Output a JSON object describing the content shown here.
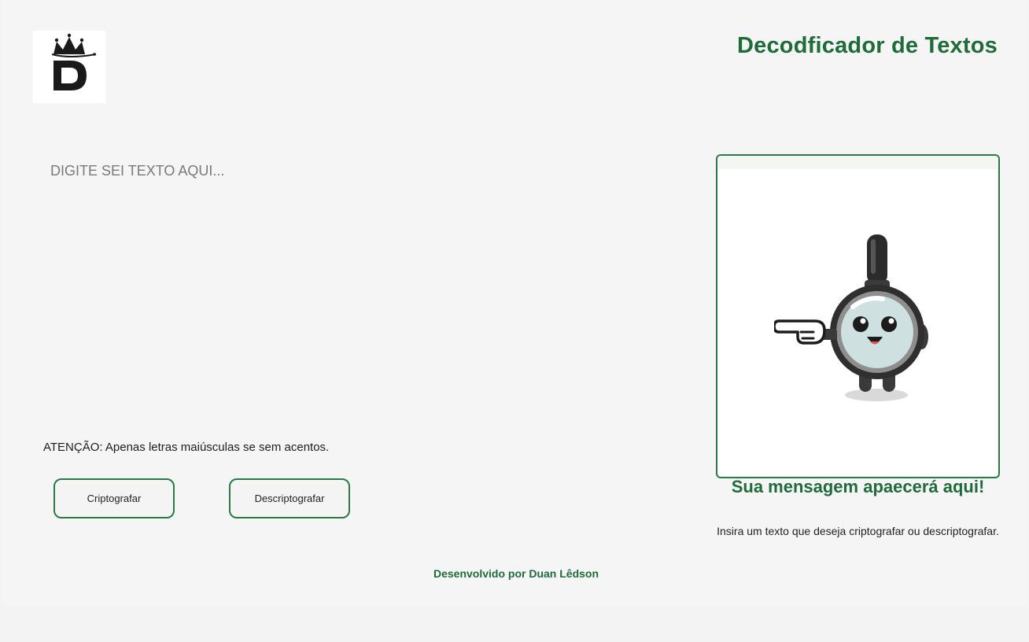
{
  "header": {
    "logo_icon": "crowned-letter-d-logo",
    "title": "Decodficador de Textos"
  },
  "input": {
    "placeholder": "DIGITE SEI TEXTO AQUI...",
    "value": ""
  },
  "warning_text": "ATENÇÃO: Apenas letras maiúsculas se sem acentos.",
  "buttons": {
    "encrypt_label": "Criptografar",
    "decrypt_label": "Descriptografar"
  },
  "output": {
    "illustration_icon": "magnifying-glass-mascot-pointing",
    "title": "Sua mensagem apaecerá aqui!",
    "subtitle": "Insira um texto que deseja criptografar ou descriptografar."
  },
  "footer": {
    "credit": "Desenvolvido por Duan Lêdson"
  },
  "colors": {
    "accent": "#1f6b3a",
    "border": "#2a7a46",
    "background": "#f5f5f5"
  }
}
